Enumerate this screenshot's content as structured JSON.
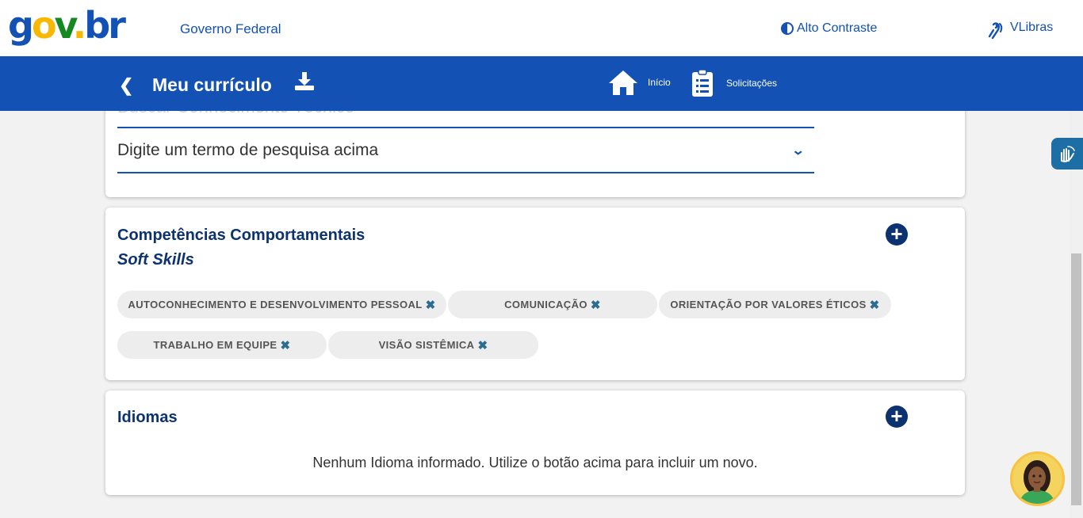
{
  "govbar": {
    "logo": {
      "g": "g",
      "o": "o",
      "v": "v",
      "dot": ".",
      "br": "br"
    },
    "title": "Governo Federal",
    "contrast_label": "Alto Contraste",
    "vlibras_label": "VLibras"
  },
  "header": {
    "back_icon": "chevron-left-icon",
    "title": "Meu currículo",
    "download_icon": "download-icon",
    "nav": [
      {
        "label": "Início",
        "icon": "home-icon"
      },
      {
        "label": "Solicitações",
        "icon": "clipboard-icon"
      }
    ]
  },
  "technical": {
    "search_placeholder": "Buscar Conhecimento Técnico",
    "select_text": "Digite um termo de pesquisa acima"
  },
  "behavioral": {
    "title": "Competências Comportamentais",
    "subtitle": "Soft Skills",
    "skills": [
      "AUTOCONHECIMENTO E DESENVOLVIMENTO PESSOAL",
      "COMUNICAÇÃO",
      "ORIENTAÇÃO POR VALORES ÉTICOS",
      "TRABALHO EM EQUIPE",
      "VISÃO SISTÊMICA"
    ],
    "remove_glyph": "✖"
  },
  "languages": {
    "title": "Idiomas",
    "empty_message": "Nenhum Idioma informado. Utilize o botão acima para incluir um novo."
  },
  "colors": {
    "primary": "#1351b4",
    "dark_blue": "#0c326f",
    "chip_bg": "#ededed",
    "chip_x": "#2c6d8f"
  }
}
